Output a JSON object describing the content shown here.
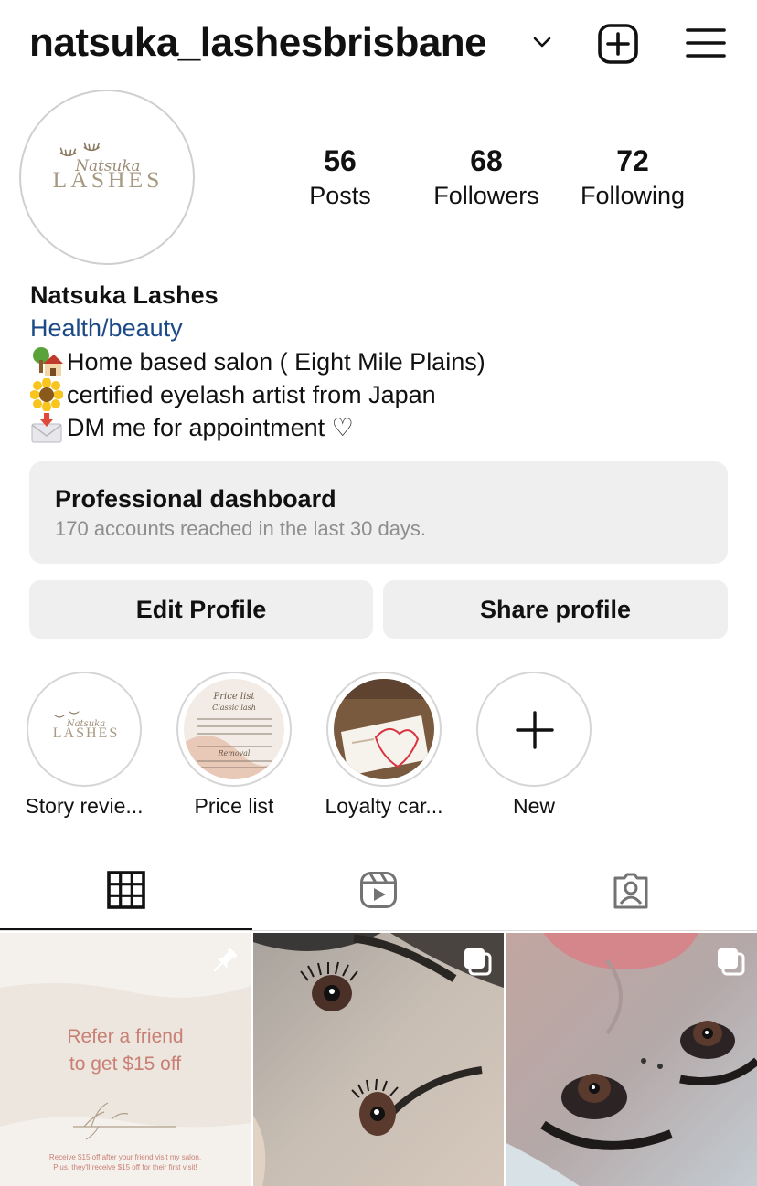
{
  "header": {
    "username": "natsuka_lashesbrisbane"
  },
  "profile": {
    "logo_script": "Natsuka",
    "logo_text": "LASHES",
    "stats": [
      {
        "value": "56",
        "label": "Posts"
      },
      {
        "value": "68",
        "label": "Followers"
      },
      {
        "value": "72",
        "label": "Following"
      }
    ],
    "name": "Natsuka Lashes",
    "category": "Health/beauty",
    "bio_lines": [
      {
        "emoji": "house-tree-emoji",
        "text": "Home based salon ( Eight Mile Plains)"
      },
      {
        "emoji": "sunflower-emoji",
        "text": "certified eyelash artist from Japan"
      },
      {
        "emoji": "envelope-arrow-emoji",
        "text": "DM me for appointment ♡"
      }
    ]
  },
  "dashboard": {
    "title": "Professional dashboard",
    "subtitle": "170 accounts reached in the last 30 days."
  },
  "buttons": {
    "edit": "Edit Profile",
    "share": "Share profile"
  },
  "highlights": [
    {
      "label": "Story revie..."
    },
    {
      "label": "Price list",
      "thumb_title": "Price list",
      "thumb_sub": "Classic lash",
      "thumb_sub2": "Removal"
    },
    {
      "label": "Loyalty car..."
    },
    {
      "label": "New"
    }
  ],
  "tabs": [
    {
      "name": "grid",
      "icon": "grid-icon",
      "selected": true
    },
    {
      "name": "reels",
      "icon": "reels-icon",
      "selected": false
    },
    {
      "name": "tagged",
      "icon": "tagged-icon",
      "selected": false
    }
  ],
  "posts": [
    {
      "kind": "graphic",
      "headline_1": "Refer a friend",
      "headline_2": "to get $15 off",
      "fine_1": "Receive $15 off after your friend visit my salon.",
      "fine_2": "Plus, they'll receive $15 off for their first visit!",
      "overlay": "pin-icon"
    },
    {
      "kind": "photo",
      "overlay": "carousel-icon"
    },
    {
      "kind": "photo",
      "overlay": "carousel-icon"
    }
  ],
  "colors": {
    "link_blue": "#1c4a86",
    "button_gray": "#efefef",
    "secondary_text": "#8e8e8e",
    "promo_text": "#c97f73",
    "logo_gold": "#a89a82"
  }
}
